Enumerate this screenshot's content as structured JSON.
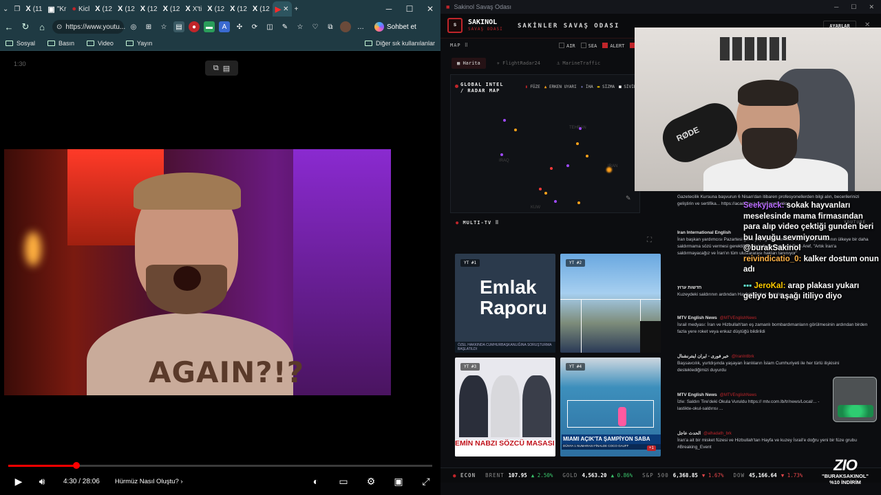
{
  "browser": {
    "tabs": [
      {
        "icon": "X",
        "label": "(11"
      },
      {
        "icon": "▣",
        "label": "\"Kr"
      },
      {
        "icon": "●",
        "label": "Kicl"
      },
      {
        "icon": "X",
        "label": "(12"
      },
      {
        "icon": "X",
        "label": "(12"
      },
      {
        "icon": "X",
        "label": "(12"
      },
      {
        "icon": "X",
        "label": "(12"
      },
      {
        "icon": "X",
        "label": "X'ti"
      },
      {
        "icon": "X",
        "label": "(12"
      },
      {
        "icon": "X",
        "label": "(12"
      },
      {
        "icon": "X",
        "label": "(12"
      },
      {
        "icon": "X",
        "label": "(12"
      }
    ],
    "url": "https://www.youtu...",
    "copilot_label": "Sohbet et",
    "favorites": [
      "Sosyal",
      "Basın",
      "Video",
      "Yayın"
    ],
    "other_favorites": "Diğer sık kullanılanlar"
  },
  "player": {
    "timestamp_label": "1:30",
    "shirt_text": "AGAIN?!?",
    "progress": 0.16,
    "time": "4:30 / 28:06",
    "chapter": "Hürmüz Nasıl Oluştu?"
  },
  "app": {
    "window_title": "Sakinol Savaş Odası",
    "brand": "SAKINOL",
    "brand_sub": "SAVAŞ ODASI",
    "header_title": "SAKİNLER SAVAŞ ODASI",
    "settings_label": "AYARLAR",
    "map_label": "MAP",
    "layers": [
      "AIR",
      "SEA",
      "ALERT"
    ],
    "tabs": [
      "Harita",
      "FlightRadar24",
      "MarineTraffic"
    ],
    "map_title_1": "GLOBAL INTEL",
    "map_title_2": "/ RADAR MAP",
    "map_legend": [
      "FÜZE",
      "ERKEN UYARI",
      "İHA",
      "SİZMA",
      "SİVİL"
    ],
    "map_places": [
      "TEHRAN",
      "IRAQ",
      "IRAN",
      "KUW"
    ],
    "multitv_label": "MULTI-TV",
    "multitv_source": "YOUTUBE",
    "tiles": [
      {
        "label": "YT #1",
        "title": "Emlak Raporu",
        "strip": "ÖZEL HAKKINDA CUMHURBAŞKANLIĞINA SORUŞTURMA BAŞLATILDI"
      },
      {
        "label": "YT #2"
      },
      {
        "label": "YT #3",
        "title": "EMİN NABZI SÖZCÜ MASASI"
      },
      {
        "label": "YT #4",
        "title": "MIAMI AÇIK'TA ŞAMPİYON SABA",
        "sub": "DÜNYA 1 NUMARASI FİNALDE COCO GAUFF",
        "badge": "+1"
      }
    ]
  },
  "feed": [
    {
      "source": "",
      "handle": "",
      "body": "Gazetecilik Kursuna başvurun 6 Nisan'dan itibaren profesyonellerden bilgi alın, becerilerinizi geliştirin ve sertifika... https://academy.t.com/#application"
    },
    {
      "source": "Iran International English",
      "handle": "",
      "body": "İran başkan yardımcısı Pazartesi günü yaptığı açıklamada, İran'ın düşmanlarının ülkeye bir daha saldırmama sözü vermesi gerektiğini söyledi. Muhammed Rıza Aref, \"Artık İran'a saldırmayacağız ve İran'ın tüm uluslararası hakları tanınıyor\""
    },
    {
      "source": "חדשות ערוץ",
      "handle": "",
      "body": "Kuzeydeki saldırının ardından Hayfa'da roket uyarıları"
    },
    {
      "source": "MTV English News",
      "handle": "@MTVEnglishNews",
      "body": "İsrail medyası: İran ve Hizbullah'tan eş zamanlı bombardımanların görülmesinin ardından birden fazla yere roket veya enkaz düştüğü bildirildi"
    },
    {
      "source": "خبر فوری - ایران اینترنشنال",
      "handle": "@IranIntlbrk",
      "body": "Başsavcılık, yurtdışında yaşayan İranlıların İslam Cumhuriyeti ile her türlü ilişkisini desteklediğimizi duyurdu"
    },
    {
      "source": "MTV English News",
      "handle": "@MTVEnglishNews",
      "body": "İzle: Saldırı Tire'deki Okula Vuruldu https:// mtv.com.lb/tr/news/Local/... -lastikte-okul-saldırısı ..."
    },
    {
      "source": "الحدث عاجل",
      "handle": "@alhadath_brk",
      "body": "İran'a ait bir misket füzesi ve Hizbullah'tan Hayfa ve kuzey İsrail'e doğru yeni bir füze grubu #Breaking_Event"
    }
  ],
  "chat": [
    {
      "user": "Seekyjack:",
      "text": "sokak hayvanları meselesinde mama firmasından para alıp video çektiği gunden beri bu lavuğu sevmiyorum @burakSakinol"
    },
    {
      "user": "reivindicatio_0:",
      "text": "kalker dostum onun adı"
    },
    {
      "user": "JeroKal:",
      "text": "arap plakası yukarı geliyo bu aşağı itiliyo diyo"
    }
  ],
  "ticker": {
    "label": "ECON",
    "items": [
      {
        "name": "BRENT",
        "value": "107.95",
        "change": "▲ 2.50%",
        "dir": "up"
      },
      {
        "name": "GOLD",
        "value": "4,563.20",
        "change": "▲ 0.86%",
        "dir": "up"
      },
      {
        "name": "S&P 500",
        "value": "6,368.85",
        "change": "▼ 1.67%",
        "dir": "dn"
      },
      {
        "name": "DOW",
        "value": "45,166.64",
        "change": "▼ 1.73%",
        "dir": "dn"
      }
    ]
  },
  "sponsor": {
    "logo": "ZIO",
    "line1": "\"BURAKSAKINOL\"",
    "line2": "%10 İNDİRİM"
  }
}
